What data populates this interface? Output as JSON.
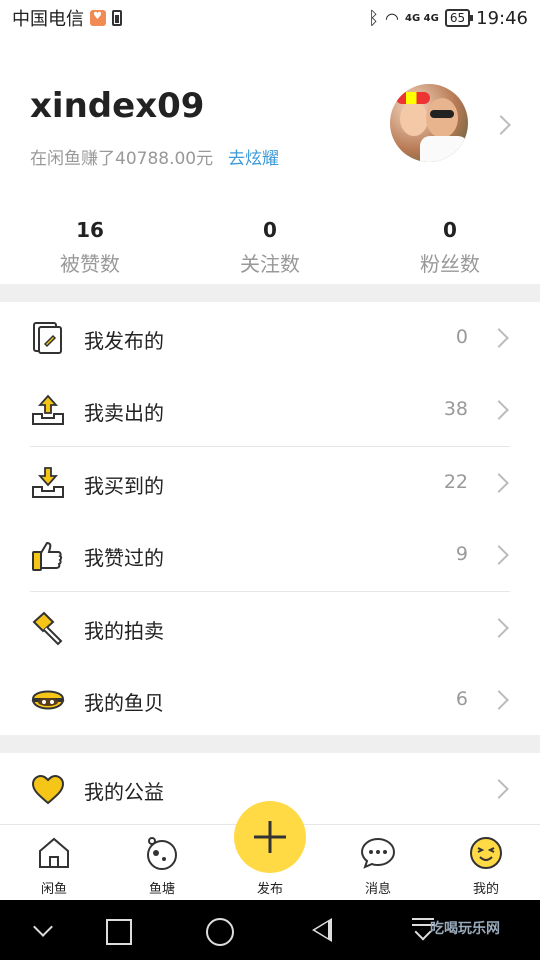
{
  "status_bar": {
    "carrier": "中国电信",
    "signal": "4G 4G",
    "battery": "65",
    "time": "19:46"
  },
  "profile": {
    "username": "xindex09",
    "earned": "在闲鱼赚了40788.00元",
    "show_off_link": "去炫耀"
  },
  "stats": [
    {
      "value": "16",
      "label": "被赞数"
    },
    {
      "value": "0",
      "label": "关注数"
    },
    {
      "value": "0",
      "label": "粉丝数"
    }
  ],
  "menu_group_1": [
    {
      "label": "我发布的",
      "count": "0",
      "icon": "document-edit-icon"
    },
    {
      "label": "我卖出的",
      "count": "38",
      "icon": "box-upload-icon"
    },
    {
      "label": "我买到的",
      "count": "22",
      "icon": "box-download-icon"
    },
    {
      "label": "我赞过的",
      "count": "9",
      "icon": "thumbs-up-icon"
    },
    {
      "label": "我的拍卖",
      "count": "",
      "icon": "auction-hammer-icon"
    },
    {
      "label": "我的鱼贝",
      "count": "6",
      "icon": "shell-icon"
    }
  ],
  "menu_group_2": [
    {
      "label": "我的公益",
      "count": "",
      "icon": "heart-icon"
    }
  ],
  "tabs": [
    {
      "label": "闲鱼",
      "icon": "home-icon"
    },
    {
      "label": "鱼塘",
      "icon": "pond-icon"
    },
    {
      "label": "发布",
      "icon": "plus-icon"
    },
    {
      "label": "消息",
      "icon": "chat-icon"
    },
    {
      "label": "我的",
      "icon": "smiley-icon"
    }
  ],
  "colors": {
    "accent_yellow": "#ffda44",
    "link_blue": "#3d9ad9"
  },
  "watermark": "吃喝玩乐网"
}
